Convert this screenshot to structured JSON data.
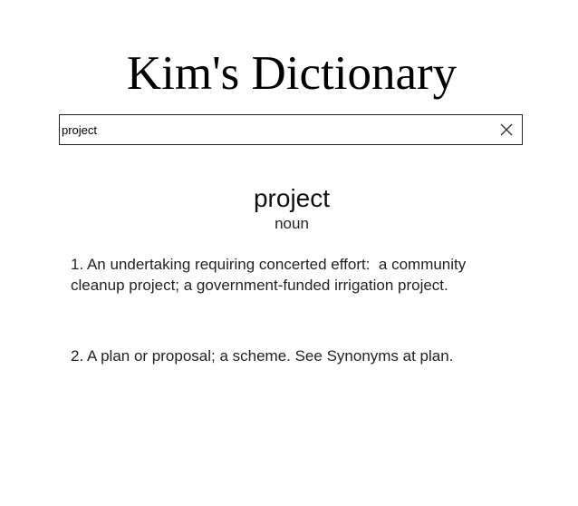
{
  "header": {
    "title": "Kim's Dictionary"
  },
  "search": {
    "value": "project",
    "clear_icon": "close-icon"
  },
  "entry": {
    "word": "project",
    "part_of_speech": "noun",
    "definitions": [
      "1. An undertaking requiring concerted effort:  a community cleanup project; a government-funded irrigation project.",
      "2. A plan or proposal; a scheme. See Synonyms at plan."
    ]
  },
  "colors": {
    "background": "#ffffff",
    "text": "#222222",
    "border": "#222222"
  }
}
